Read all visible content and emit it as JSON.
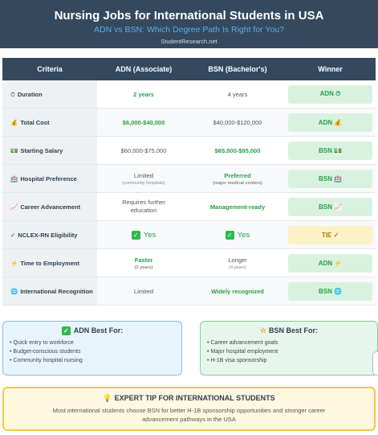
{
  "header": {
    "title": "Nursing Jobs for International Students in USA",
    "subtitle": "ADN vs BSN: Which Degree Path Is Right for You?",
    "site": "StudentResearch.net"
  },
  "table": {
    "headers": [
      "Criteria",
      "ADN (Associate)",
      "BSN (Bachelor's)",
      "Winner"
    ],
    "rows": [
      {
        "icon": "⏱",
        "criteria": "Duration",
        "adn": "2 years",
        "adn_note": "",
        "bsn": "4 years",
        "bsn_note": "",
        "winner": "ADN ⏱"
      },
      {
        "icon": "💰",
        "criteria": "Total Cost",
        "adn": "$6,000-$40,000",
        "adn_note": "",
        "bsn": "$40,000-$120,000",
        "bsn_note": "",
        "winner": "ADN 💰"
      },
      {
        "icon": "💵",
        "criteria": "Starting Salary",
        "adn": "$60,000-$75,000",
        "adn_note": "",
        "bsn": "$65,000-$95,000",
        "bsn_note": "",
        "winner": "BSN 💵"
      },
      {
        "icon": "🏥",
        "criteria": "Hospital Preference",
        "adn": "Limited",
        "adn_note": "(community hospitals)",
        "bsn": "Preferred",
        "bsn_note": "(major medical centers)",
        "winner": "BSN 🏥"
      },
      {
        "icon": "📈",
        "criteria": "Career Advancement",
        "adn": "Requires further education",
        "adn_note": "",
        "bsn": "Management-ready",
        "bsn_note": "",
        "winner": "BSN 📈"
      },
      {
        "icon": "✓",
        "criteria": "NCLEX-RN Eligibility",
        "adn": "Yes",
        "adn_note": "",
        "bsn": "Yes",
        "bsn_note": "",
        "winner": "TIE ✓"
      },
      {
        "icon": "⚡",
        "criteria": "Time to Employment",
        "adn": "Faster",
        "adn_note": "(2 years)",
        "bsn": "Longer",
        "bsn_note": "(4 years)",
        "winner": "ADN ⚡"
      },
      {
        "icon": "🌐",
        "criteria": "International Recognition",
        "adn": "Limited",
        "adn_note": "",
        "bsn": "Widely recognized",
        "bsn_note": "",
        "winner": "BSN 🌐"
      }
    ]
  },
  "adn_box": {
    "title": "ADN Best For:",
    "items": [
      "Quick entry to workforce",
      "Budget-conscious students",
      "Community hospital nursing"
    ]
  },
  "bsn_box": {
    "title": "BSN Best For:",
    "items": [
      "Career advancement goals",
      "Major hospital employment",
      "H-1B visa sponsorship"
    ]
  },
  "tip": {
    "title": "EXPERT TIP FOR INTERNATIONAL STUDENTS",
    "text": "Most international students choose BSN for better H-1B sponsorship opportunities and stronger career advancement pathways in the USA"
  },
  "colors": {
    "header_bg": "#34495e",
    "accent_green": "#27a046",
    "subtitle_blue": "#5dade2",
    "tip_border": "#f4c845"
  }
}
